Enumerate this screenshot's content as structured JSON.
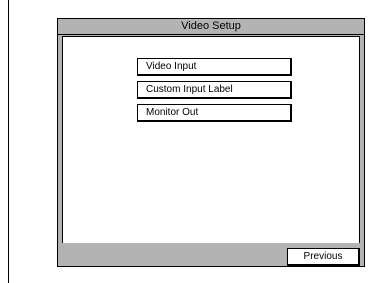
{
  "dialog": {
    "title": "Video Setup"
  },
  "menu": {
    "items": [
      {
        "label": "Video Input"
      },
      {
        "label": "Custom Input Label"
      },
      {
        "label": "Monitor Out"
      }
    ]
  },
  "footer": {
    "previous_label": "Previous"
  },
  "colors": {
    "frame_gray": "#b3b3b3",
    "panel_white": "#ffffff",
    "border": "#000000"
  }
}
